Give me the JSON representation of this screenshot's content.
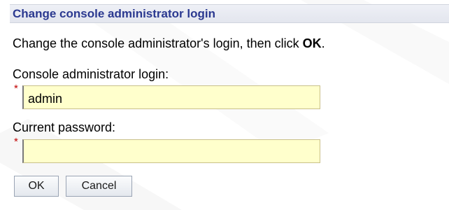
{
  "title": "Change console administrator login",
  "instruction": {
    "prefix": "Change the console administrator's login, then click ",
    "emphasis": "OK",
    "suffix": "."
  },
  "fields": {
    "login": {
      "label": "Console administrator login:",
      "required_marker": "*",
      "value": "admin"
    },
    "password": {
      "label": "Current password:",
      "required_marker": "*",
      "value": ""
    }
  },
  "buttons": {
    "ok_label": "OK",
    "cancel_label": "Cancel"
  },
  "colors": {
    "title_text": "#2b3990",
    "input_background": "#ffffcc",
    "required_marker": "#c00000"
  }
}
